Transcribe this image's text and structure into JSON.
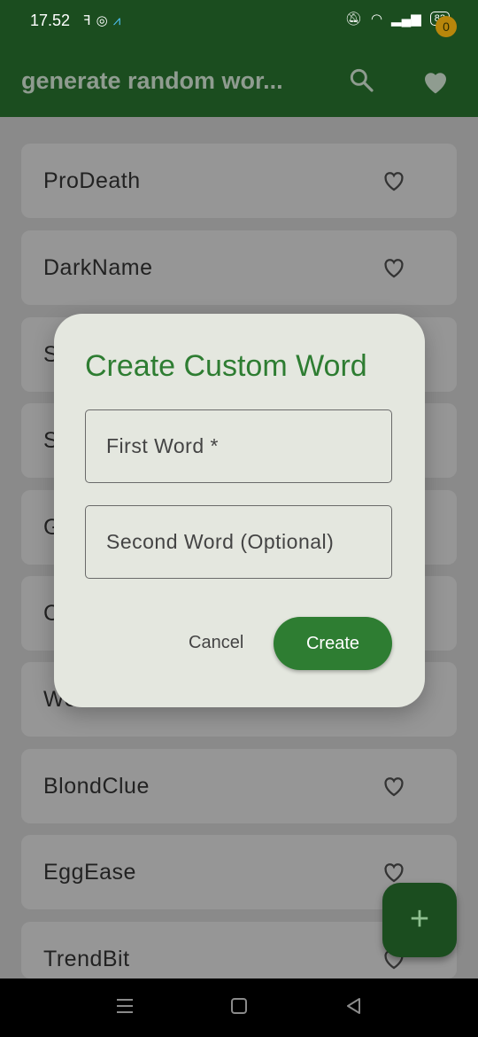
{
  "status": {
    "time": "17.52",
    "left_icons": [
      "flash-icon",
      "instagram-icon",
      "app-icon"
    ],
    "battery": "82"
  },
  "appbar": {
    "title": "generate random wor...",
    "favorites_count": "0"
  },
  "list": {
    "items": [
      {
        "word": "ProDeath"
      },
      {
        "word": "DarkName"
      },
      {
        "word": "S"
      },
      {
        "word": "S"
      },
      {
        "word": "G"
      },
      {
        "word": "C"
      },
      {
        "word": "WebFan"
      },
      {
        "word": "BlondClue"
      },
      {
        "word": "EggEase"
      },
      {
        "word": "TrendBit"
      }
    ]
  },
  "dialog": {
    "title": "Create Custom Word",
    "first_placeholder": "First Word *",
    "second_placeholder": "Second Word (Optional)",
    "cancel_label": "Cancel",
    "create_label": "Create"
  },
  "fab": {
    "label": "+"
  },
  "colors": {
    "primary_dark": "#1b4d1f",
    "accent": "#2e7d32",
    "badge": "#b8860b"
  }
}
